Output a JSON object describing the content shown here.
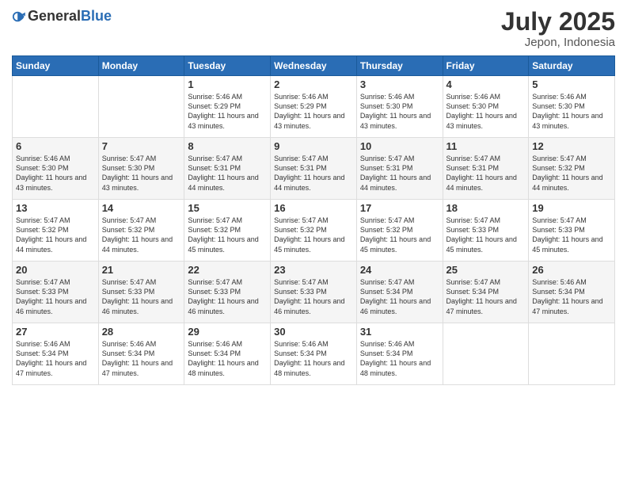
{
  "header": {
    "logo_general": "General",
    "logo_blue": "Blue",
    "title": "July 2025",
    "location": "Jepon, Indonesia"
  },
  "calendar": {
    "weekdays": [
      "Sunday",
      "Monday",
      "Tuesday",
      "Wednesday",
      "Thursday",
      "Friday",
      "Saturday"
    ],
    "weeks": [
      [
        {
          "day": "",
          "info": ""
        },
        {
          "day": "",
          "info": ""
        },
        {
          "day": "1",
          "info": "Sunrise: 5:46 AM\nSunset: 5:29 PM\nDaylight: 11 hours and 43 minutes."
        },
        {
          "day": "2",
          "info": "Sunrise: 5:46 AM\nSunset: 5:29 PM\nDaylight: 11 hours and 43 minutes."
        },
        {
          "day": "3",
          "info": "Sunrise: 5:46 AM\nSunset: 5:30 PM\nDaylight: 11 hours and 43 minutes."
        },
        {
          "day": "4",
          "info": "Sunrise: 5:46 AM\nSunset: 5:30 PM\nDaylight: 11 hours and 43 minutes."
        },
        {
          "day": "5",
          "info": "Sunrise: 5:46 AM\nSunset: 5:30 PM\nDaylight: 11 hours and 43 minutes."
        }
      ],
      [
        {
          "day": "6",
          "info": "Sunrise: 5:46 AM\nSunset: 5:30 PM\nDaylight: 11 hours and 43 minutes."
        },
        {
          "day": "7",
          "info": "Sunrise: 5:47 AM\nSunset: 5:30 PM\nDaylight: 11 hours and 43 minutes."
        },
        {
          "day": "8",
          "info": "Sunrise: 5:47 AM\nSunset: 5:31 PM\nDaylight: 11 hours and 44 minutes."
        },
        {
          "day": "9",
          "info": "Sunrise: 5:47 AM\nSunset: 5:31 PM\nDaylight: 11 hours and 44 minutes."
        },
        {
          "day": "10",
          "info": "Sunrise: 5:47 AM\nSunset: 5:31 PM\nDaylight: 11 hours and 44 minutes."
        },
        {
          "day": "11",
          "info": "Sunrise: 5:47 AM\nSunset: 5:31 PM\nDaylight: 11 hours and 44 minutes."
        },
        {
          "day": "12",
          "info": "Sunrise: 5:47 AM\nSunset: 5:32 PM\nDaylight: 11 hours and 44 minutes."
        }
      ],
      [
        {
          "day": "13",
          "info": "Sunrise: 5:47 AM\nSunset: 5:32 PM\nDaylight: 11 hours and 44 minutes."
        },
        {
          "day": "14",
          "info": "Sunrise: 5:47 AM\nSunset: 5:32 PM\nDaylight: 11 hours and 44 minutes."
        },
        {
          "day": "15",
          "info": "Sunrise: 5:47 AM\nSunset: 5:32 PM\nDaylight: 11 hours and 45 minutes."
        },
        {
          "day": "16",
          "info": "Sunrise: 5:47 AM\nSunset: 5:32 PM\nDaylight: 11 hours and 45 minutes."
        },
        {
          "day": "17",
          "info": "Sunrise: 5:47 AM\nSunset: 5:32 PM\nDaylight: 11 hours and 45 minutes."
        },
        {
          "day": "18",
          "info": "Sunrise: 5:47 AM\nSunset: 5:33 PM\nDaylight: 11 hours and 45 minutes."
        },
        {
          "day": "19",
          "info": "Sunrise: 5:47 AM\nSunset: 5:33 PM\nDaylight: 11 hours and 45 minutes."
        }
      ],
      [
        {
          "day": "20",
          "info": "Sunrise: 5:47 AM\nSunset: 5:33 PM\nDaylight: 11 hours and 46 minutes."
        },
        {
          "day": "21",
          "info": "Sunrise: 5:47 AM\nSunset: 5:33 PM\nDaylight: 11 hours and 46 minutes."
        },
        {
          "day": "22",
          "info": "Sunrise: 5:47 AM\nSunset: 5:33 PM\nDaylight: 11 hours and 46 minutes."
        },
        {
          "day": "23",
          "info": "Sunrise: 5:47 AM\nSunset: 5:33 PM\nDaylight: 11 hours and 46 minutes."
        },
        {
          "day": "24",
          "info": "Sunrise: 5:47 AM\nSunset: 5:34 PM\nDaylight: 11 hours and 46 minutes."
        },
        {
          "day": "25",
          "info": "Sunrise: 5:47 AM\nSunset: 5:34 PM\nDaylight: 11 hours and 47 minutes."
        },
        {
          "day": "26",
          "info": "Sunrise: 5:46 AM\nSunset: 5:34 PM\nDaylight: 11 hours and 47 minutes."
        }
      ],
      [
        {
          "day": "27",
          "info": "Sunrise: 5:46 AM\nSunset: 5:34 PM\nDaylight: 11 hours and 47 minutes."
        },
        {
          "day": "28",
          "info": "Sunrise: 5:46 AM\nSunset: 5:34 PM\nDaylight: 11 hours and 47 minutes."
        },
        {
          "day": "29",
          "info": "Sunrise: 5:46 AM\nSunset: 5:34 PM\nDaylight: 11 hours and 48 minutes."
        },
        {
          "day": "30",
          "info": "Sunrise: 5:46 AM\nSunset: 5:34 PM\nDaylight: 11 hours and 48 minutes."
        },
        {
          "day": "31",
          "info": "Sunrise: 5:46 AM\nSunset: 5:34 PM\nDaylight: 11 hours and 48 minutes."
        },
        {
          "day": "",
          "info": ""
        },
        {
          "day": "",
          "info": ""
        }
      ]
    ]
  }
}
